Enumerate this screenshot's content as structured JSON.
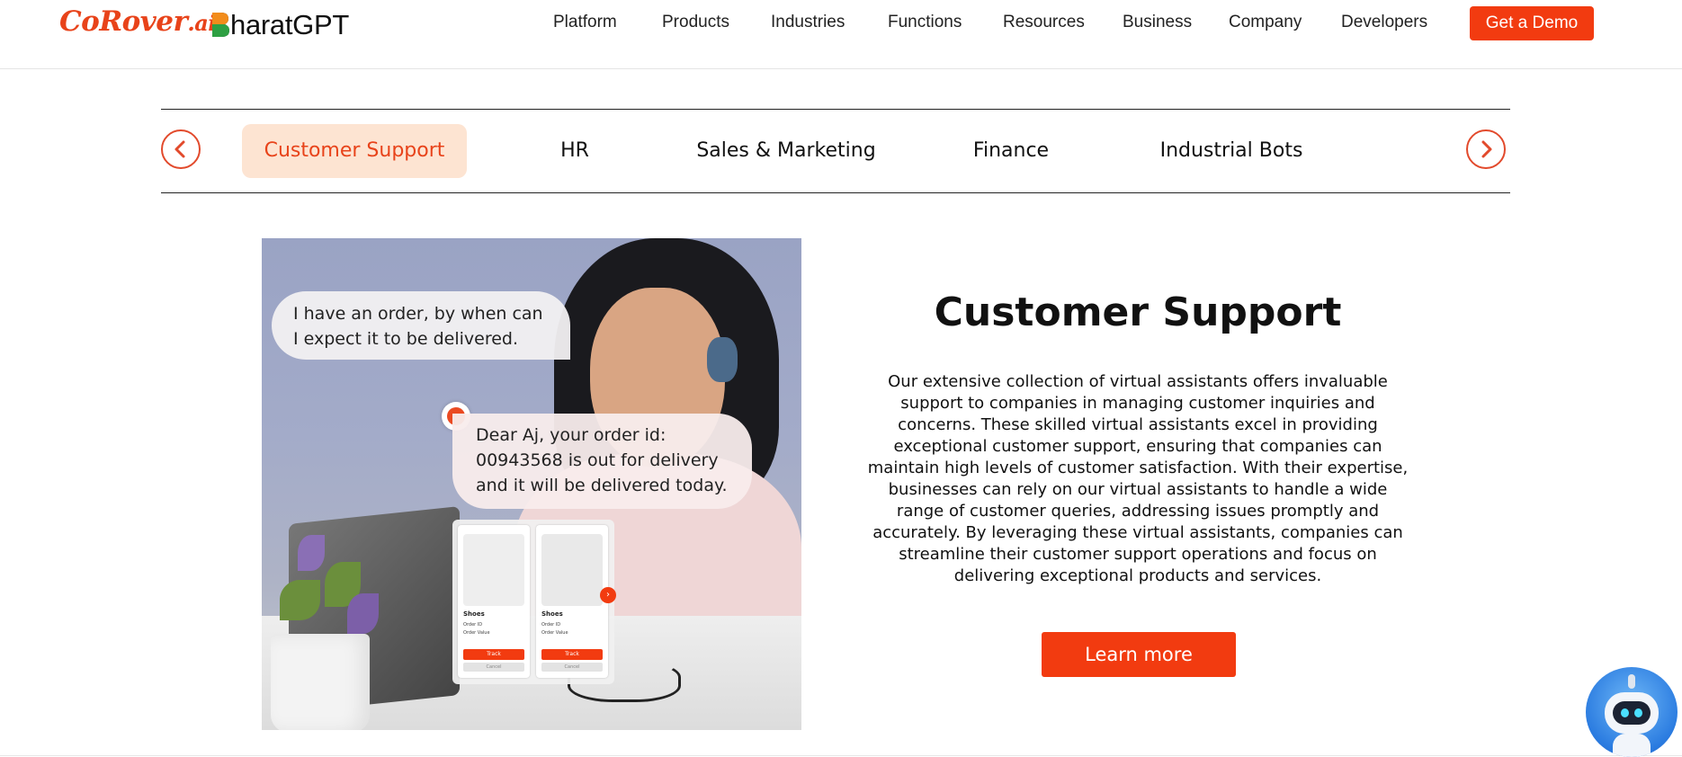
{
  "header": {
    "logo_corover": "CoRover",
    "logo_corover_suffix": ".ai",
    "logo_bharat": "haratGPT",
    "nav": [
      "Platform",
      "Products",
      "Industries",
      "Functions",
      "Resources",
      "Business",
      "Company",
      "Developers"
    ],
    "demo_label": "Get a Demo"
  },
  "tabs": {
    "items": [
      "Customer Support",
      "HR",
      "Sales & Marketing",
      "Finance",
      "Industrial Bots"
    ],
    "active_index": 0,
    "prev_icon": "chevron-left-icon",
    "next_icon": "chevron-right-icon"
  },
  "image": {
    "user_message": "I have an order, by when can I expect it to be delivered.",
    "bot_message": "Dear Aj, your order id: 00943568 is out for delivery and it will be delivered today.",
    "cards": [
      {
        "label": "Shoes",
        "meta1": "Order ID",
        "meta2": "Order Value",
        "track": "Track",
        "cancel": "Cancel"
      },
      {
        "label": "Shoes",
        "meta1": "Order ID",
        "meta2": "Order Value",
        "track": "Track",
        "cancel": "Cancel"
      }
    ]
  },
  "content": {
    "title": "Customer Support",
    "body": "Our extensive collection of virtual assistants offers invaluable support to companies in managing customer inquiries and concerns. These skilled virtual assistants excel in providing exceptional customer support, ensuring that companies can maintain high levels of customer satisfaction. With their expertise, businesses can rely on our virtual assistants to handle a wide range of customer queries, addressing issues promptly and accurately. By leveraging these virtual assistants, companies can streamline their customer support operations and focus on delivering exceptional products and services.",
    "learn_more": "Learn more"
  },
  "colors": {
    "accent": "#f23b10",
    "tab_active_bg": "#fde4d2",
    "tab_active_text": "#e8431a"
  },
  "chatbot": {
    "icon": "robot-icon"
  }
}
